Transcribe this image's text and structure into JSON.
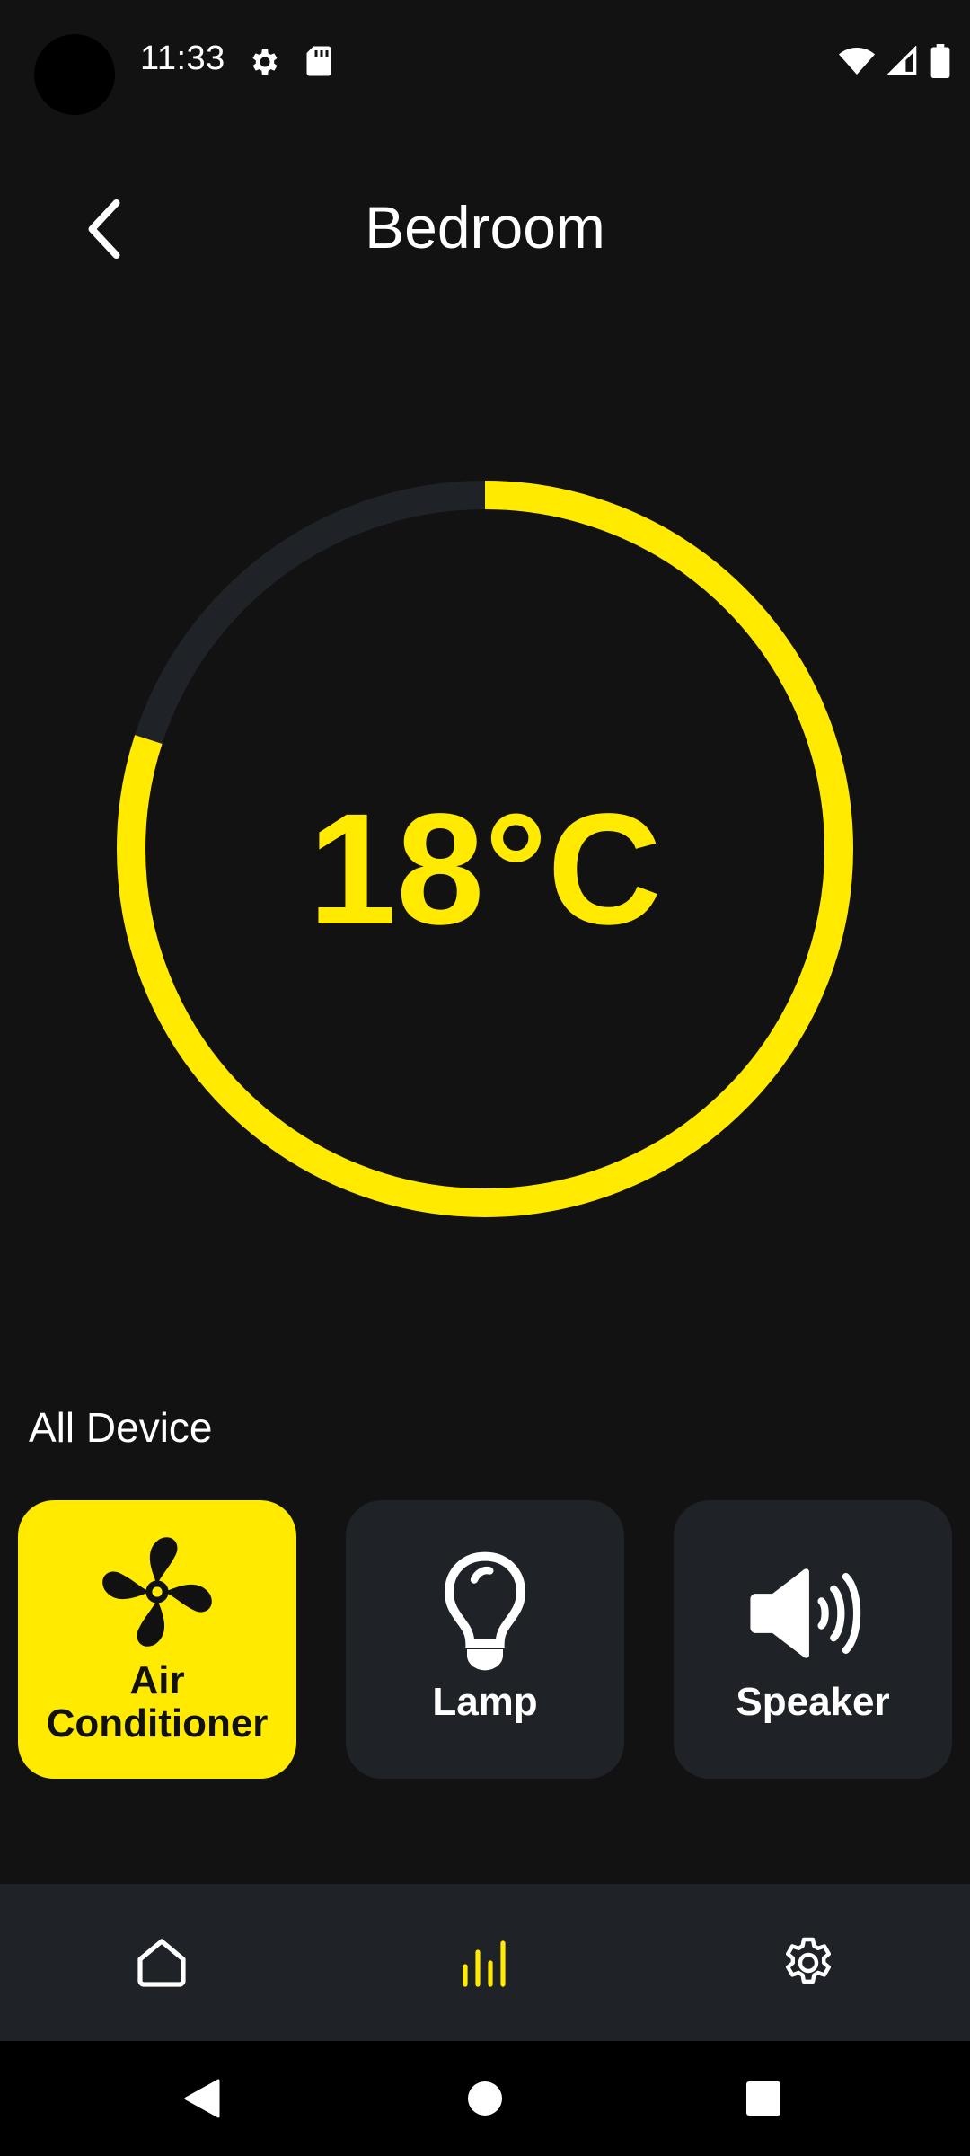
{
  "status_bar": {
    "time": "11:33",
    "icons": [
      "gear-icon",
      "sd-card-icon",
      "wifi-icon",
      "signal-icon",
      "battery-icon"
    ]
  },
  "header": {
    "title": "Bedroom",
    "back_icon": "chevron-left-icon"
  },
  "thermostat": {
    "temperature": "18°C",
    "level_fraction": 0.8,
    "accent_color": "#FFEA00",
    "track_color": "#1F2226"
  },
  "devices": {
    "section_title": "All Device",
    "items": [
      {
        "label": "Air Conditioner",
        "icon": "fan-icon",
        "active": true
      },
      {
        "label": "Lamp",
        "icon": "lightbulb-icon",
        "active": false
      },
      {
        "label": "Speaker",
        "icon": "speaker-icon",
        "active": false
      }
    ]
  },
  "bottom_nav": {
    "items": [
      {
        "icon": "home-icon",
        "active": false
      },
      {
        "icon": "bar-chart-icon",
        "active": true
      },
      {
        "icon": "settings-icon",
        "active": false
      }
    ]
  },
  "system_nav": {
    "buttons": [
      "back-triangle-icon",
      "home-circle-icon",
      "recents-square-icon"
    ]
  },
  "colors": {
    "background": "#121212",
    "accent": "#FFEA00",
    "card": "#1F2226",
    "text": "#FFFFFF"
  }
}
